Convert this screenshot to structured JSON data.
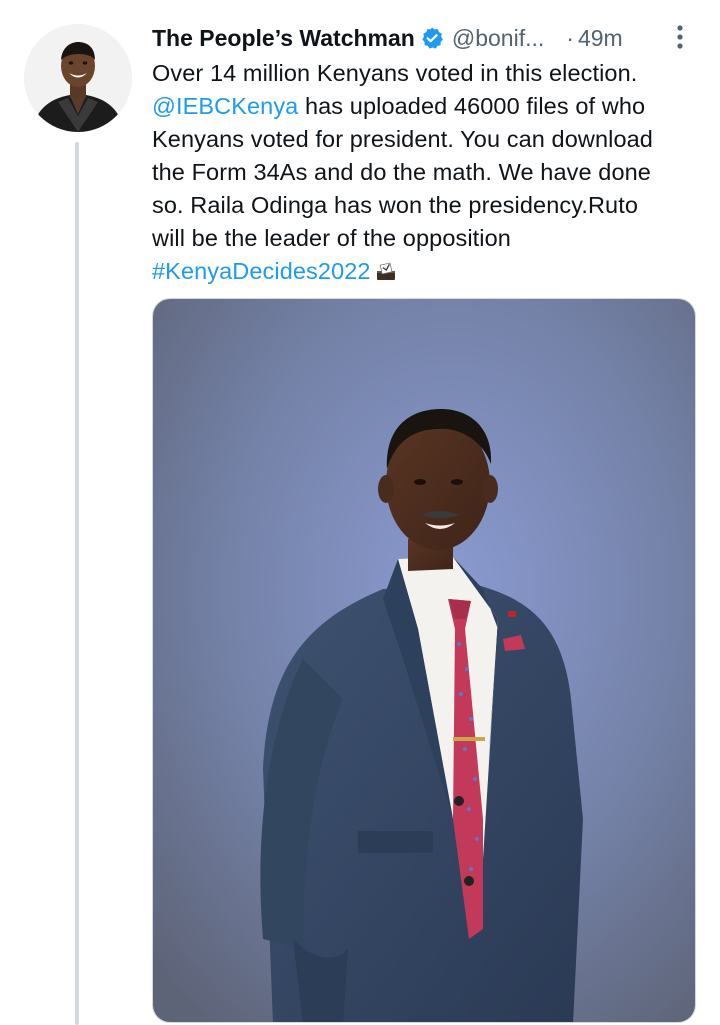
{
  "tweet": {
    "author": {
      "display_name": "The People’s Watchman",
      "handle": "@bonif...",
      "verified_icon": "verified-badge-icon",
      "avatar_icon": "avatar"
    },
    "separator": "·",
    "timestamp": "49m",
    "more_icon": "more-options-icon",
    "text_lines": {
      "l1": "Over 14 million Kenyans voted in this election.",
      "l2_mention": "@IEBCKenya",
      "l2_rest": " has uploaded 46000 files of who",
      "l3": "Kenyans voted for president. You can download",
      "l4": "the Form 34As and do the math. We have done",
      "l5": "so. Raila Odinga has won the presidency.Ruto",
      "l6": "will be the leader of the opposition",
      "l7_hashtag": "#KenyaDecides2022"
    },
    "emoji_icon": "ballot-box-icon",
    "media_icon": "photo-portrait-man-in-suit",
    "colors": {
      "link": "#1d9bf0",
      "secondary_text": "#536471",
      "thread_line": "#cfd9de",
      "verified": "#1d9bf0"
    }
  }
}
